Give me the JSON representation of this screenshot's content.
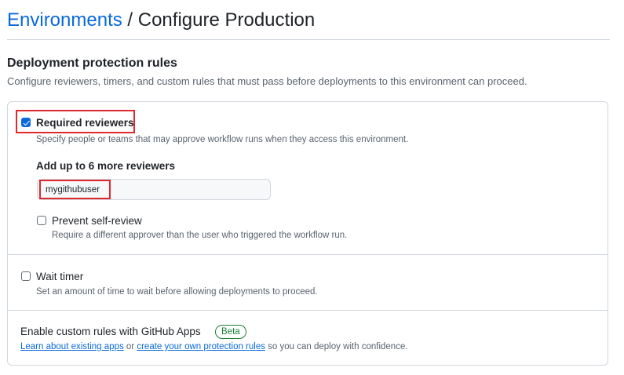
{
  "header": {
    "breadcrumb_link": "Environments",
    "separator": "/",
    "title": "Configure Production"
  },
  "section": {
    "title": "Deployment protection rules",
    "description": "Configure reviewers, timers, and custom rules that must pass before deployments to this environment can proceed."
  },
  "rules": {
    "required_reviewers": {
      "label": "Required reviewers",
      "checked": true,
      "description": "Specify people or teams that may approve workflow runs when they access this environment.",
      "add_label": "Add up to 6 more reviewers",
      "reviewer_value": "mygithubuser",
      "prevent_self_review": {
        "label": "Prevent self-review",
        "checked": false,
        "description": "Require a different approver than the user who triggered the workflow run."
      }
    },
    "wait_timer": {
      "label": "Wait timer",
      "checked": false,
      "description": "Set an amount of time to wait before allowing deployments to proceed."
    },
    "custom_rules": {
      "title": "Enable custom rules with GitHub Apps",
      "badge": "Beta",
      "link1": "Learn about existing apps",
      "text_or": " or ",
      "link2": "create your own protection rules",
      "text_suffix": " so you can deploy with confidence."
    }
  },
  "colors": {
    "link": "#0969da",
    "highlight": "#e0282d",
    "badge_green": "#1a7f37",
    "checkbox_checked": "#0969da"
  }
}
